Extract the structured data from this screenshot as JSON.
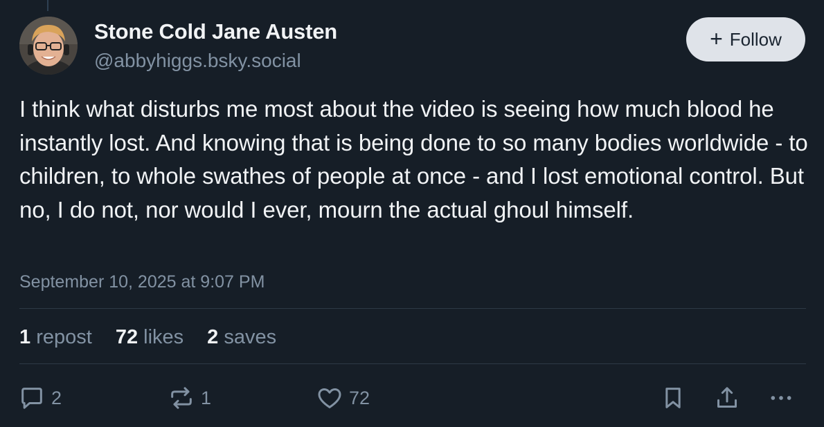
{
  "author": {
    "display_name": "Stone Cold Jane Austen",
    "handle": "@abbyhiggs.bsky.social",
    "avatar_icon": "profile-photo"
  },
  "follow_button": {
    "icon": "plus-icon",
    "label": "Follow"
  },
  "post": {
    "text": "I think what disturbs me most about the video is seeing how much blood he instantly lost. And knowing that is being done to so many bodies worldwide - to children, to whole swathes of people at once - and I lost emotional control. But no, I do not, nor would I ever, mourn the actual ghoul himself.",
    "timestamp": "September 10, 2025 at 9:07 PM"
  },
  "stats": {
    "reposts": {
      "count": "1",
      "label": "repost"
    },
    "likes": {
      "count": "72",
      "label": "likes"
    },
    "saves": {
      "count": "2",
      "label": "saves"
    }
  },
  "actions": {
    "reply": {
      "icon": "reply-icon",
      "count": "2"
    },
    "repost": {
      "icon": "repost-icon",
      "count": "1"
    },
    "like": {
      "icon": "heart-icon",
      "count": "72"
    },
    "bookmark": {
      "icon": "bookmark-icon"
    },
    "share": {
      "icon": "share-icon"
    },
    "more": {
      "icon": "more-icon"
    }
  },
  "colors": {
    "background": "#161e27",
    "text_primary": "#f1f3f5",
    "text_secondary": "#8292a3",
    "follow_button_bg": "#dfe3e9",
    "divider": "#2e3946"
  }
}
